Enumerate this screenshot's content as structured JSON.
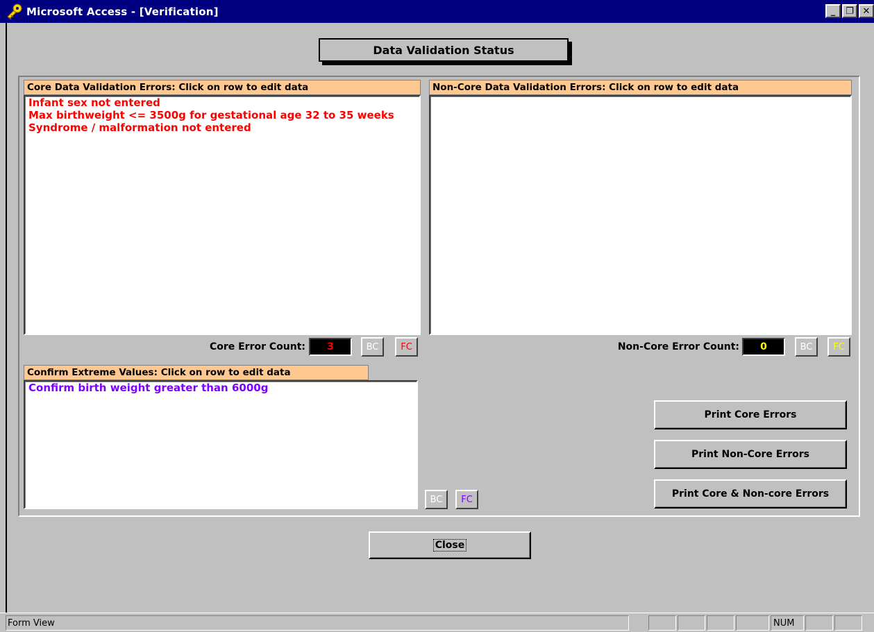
{
  "window": {
    "title": "Microsoft Access - [Verification]",
    "minimize_glyph": "_",
    "restore_glyph": "❐",
    "close_glyph": "✕"
  },
  "form": {
    "header": "Data Validation Status",
    "core": {
      "label": "Core Data Validation Errors:  Click on row to edit data",
      "rows": [
        "Infant sex not entered",
        "Max birthweight <= 3500g for gestational age 32 to 35 weeks",
        "Syndrome / malformation not entered"
      ],
      "row_color": "#ff0000",
      "count_label": "Core Error Count:",
      "count": "3",
      "count_color": "#ff0000",
      "bc_label": "BC",
      "fc_label": "FC",
      "fc_color": "#ff0000"
    },
    "noncore": {
      "label": "Non-Core Data Validation Errors:  Click on row to edit data",
      "rows": [],
      "count_label": "Non-Core Error Count:",
      "count": "0",
      "count_color": "#ffff00",
      "bc_label": "BC",
      "fc_label": "FC",
      "fc_color": "#ffff00"
    },
    "extreme": {
      "label": "Confirm Extreme Values: Click on row to edit data",
      "rows": [
        "Confirm birth weight greater than 6000g"
      ],
      "row_color": "#8000ff",
      "bc_label": "BC",
      "fc_label": "FC",
      "fc_color": "#8000ff"
    },
    "buttons": {
      "print_core": "Print Core Errors",
      "print_noncore": "Print Non-Core Errors",
      "print_both": "Print Core & Non-core Errors",
      "close": "Close"
    }
  },
  "statusbar": {
    "mode": "Form View",
    "num": "NUM"
  },
  "colors": {
    "title_bg": "#000080",
    "section_label_bg": "#ffc891",
    "face": "#c0c0c0"
  }
}
